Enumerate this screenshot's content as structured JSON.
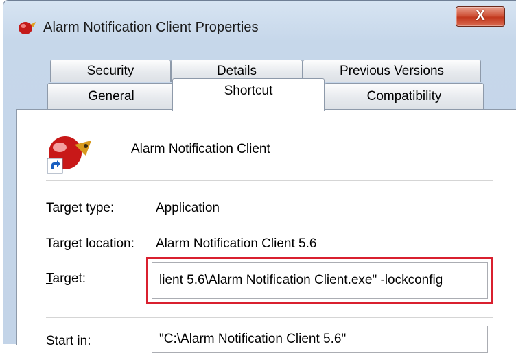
{
  "window": {
    "title": "Alarm Notification Client Properties",
    "close_label": "X"
  },
  "tabs": {
    "row1": [
      "Security",
      "Details",
      "Previous Versions"
    ],
    "row2": [
      "General",
      "Shortcut",
      "Compatibility"
    ],
    "active": "Shortcut"
  },
  "shortcut": {
    "name": "Alarm Notification Client",
    "target_type_label": "Target type:",
    "target_type_value": "Application",
    "target_location_label": "Target location:",
    "target_location_value": "Alarm Notification Client 5.6",
    "target_label_first": "T",
    "target_label_rest": "arget:",
    "target_value": "lient 5.6\\Alarm Notification Client.exe\" -lockconfig",
    "start_in_label": "Start in:",
    "start_in_value": "\"C:\\Alarm Notification Client 5.6\""
  },
  "colors": {
    "highlight_border": "#d9202f",
    "close_button": "#c2391f"
  },
  "icons": [
    "app-icon",
    "close-icon",
    "shortcut-app-icon",
    "shortcut-arrow-icon"
  ]
}
